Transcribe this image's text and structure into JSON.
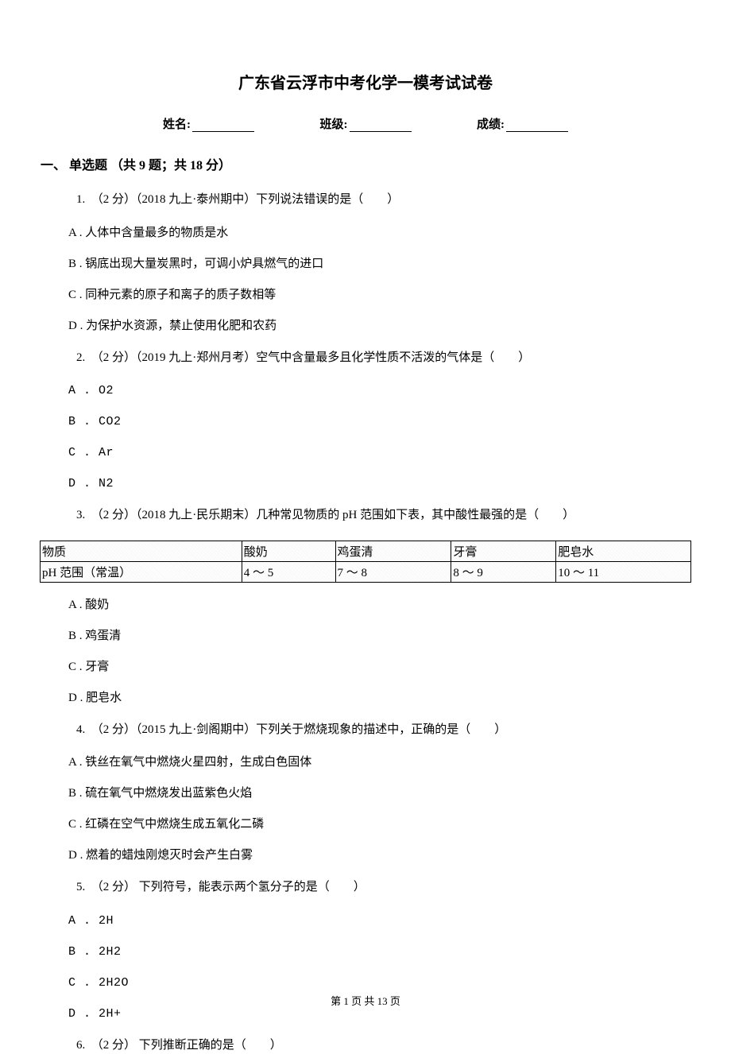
{
  "title": "广东省云浮市中考化学一模考试试卷",
  "info": {
    "name_label": "姓名:",
    "class_label": "班级:",
    "score_label": "成绩:"
  },
  "section1": "一、 单选题 （共 9 题；共 18 分）",
  "q1": {
    "stem": "1.　（2 分）（2018 九上·泰州期中）下列说法错误的是（　　）",
    "a": "A . 人体中含量最多的物质是水",
    "b": "B . 锅底出现大量炭黑时，可调小炉具燃气的进口",
    "c": "C . 同种元素的原子和离子的质子数相等",
    "d": "D . 为保护水资源，禁止使用化肥和农药"
  },
  "q2": {
    "stem": "2.　（2 分）（2019 九上·郑州月考）空气中含量最多且化学性质不活泼的气体是（　　）",
    "a": "A . O2",
    "b": "B . CO2",
    "c": "C . Ar",
    "d": "D . N2"
  },
  "q3": {
    "stem": "3.　（2 分）（2018 九上·民乐期末）几种常见物质的 pH 范围如下表，其中酸性最强的是（　　）",
    "table": {
      "r1": {
        "c0": "物质",
        "c1": "酸奶",
        "c2": "鸡蛋清",
        "c3": "牙膏",
        "c4": "肥皂水"
      },
      "r2": {
        "c0": "pH 范围（常温）",
        "c1": "4 ～ 5",
        "c2": "7 ～ 8",
        "c3": "8 ～ 9",
        "c4": "10 ～ 11"
      }
    },
    "a": "A . 酸奶",
    "b": "B . 鸡蛋清",
    "c": "C . 牙膏",
    "d": "D . 肥皂水"
  },
  "q4": {
    "stem": "4.　（2 分）（2015 九上·剑阁期中）下列关于燃烧现象的描述中，正确的是（　　）",
    "a": "A . 铁丝在氧气中燃烧火星四射，生成白色固体",
    "b": "B . 硫在氧气中燃烧发出蓝紫色火焰",
    "c": "C . 红磷在空气中燃烧生成五氧化二磷",
    "d": "D . 燃着的蜡烛刚熄灭时会产生白雾"
  },
  "q5": {
    "stem": "5.　（2 分） 下列符号，能表示两个氢分子的是（　　）",
    "a": "A . 2H",
    "b": "B . 2H2",
    "c": "C . 2H2O",
    "d": "D . 2H+"
  },
  "q6": {
    "stem": "6.　（2 分） 下列推断正确的是（　　）"
  },
  "footer": "第 1 页 共 13 页"
}
